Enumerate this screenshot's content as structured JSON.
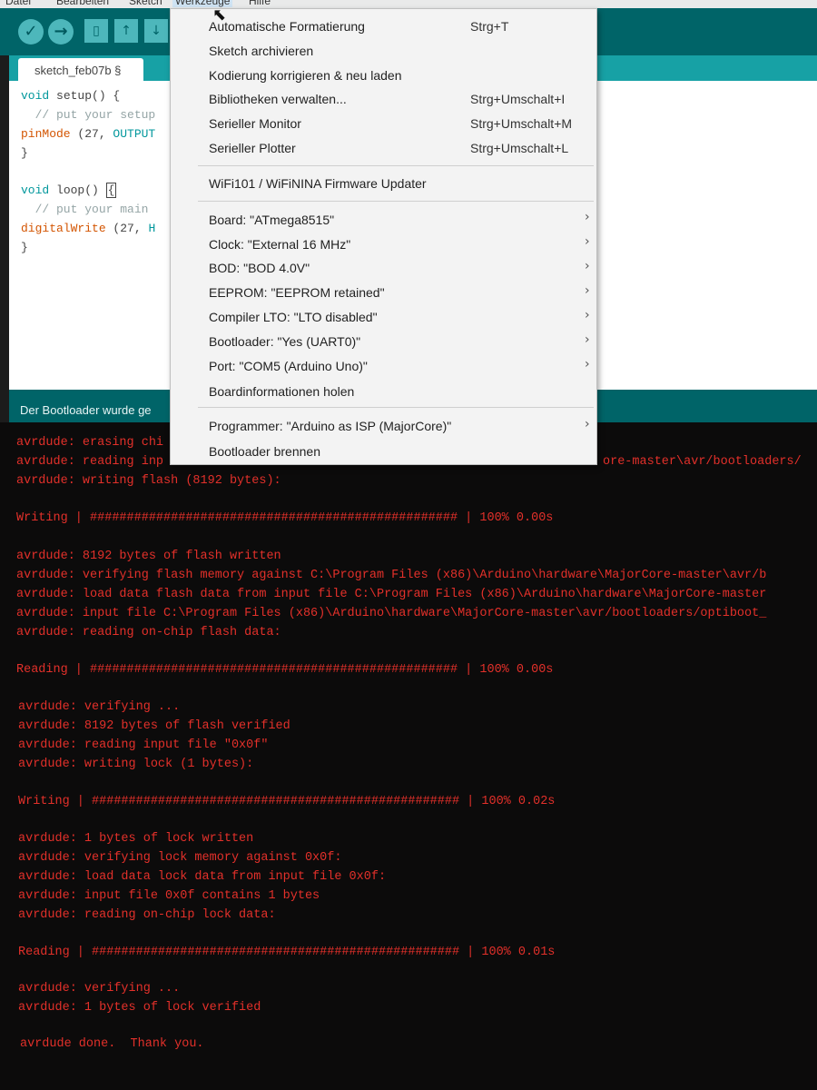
{
  "menubar": {
    "items": [
      "Datei",
      "Bearbeiten",
      "Sketch",
      "Werkzeuge",
      "Hilfe"
    ]
  },
  "toolbar": {
    "verify_icon": "check-icon",
    "upload_icon": "arrow-right-icon",
    "new_icon": "file-icon",
    "open_icon": "arrow-up-icon",
    "save_icon": "arrow-down-icon",
    "glyphs": {
      "verify": "✓",
      "upload": "→",
      "new": "▯",
      "open": "↑",
      "save": "↓"
    }
  },
  "tab": {
    "label": "sketch_feb07b §"
  },
  "editor": {
    "lines": [
      {
        "kw": "void",
        "rest": " setup() {"
      },
      {
        "comment": "  // put your setup"
      },
      {
        "fn": "pinMode",
        "rest": " (27, ",
        "const": "OUTPUT"
      },
      {
        "rest": "}"
      },
      {
        "rest": ""
      },
      {
        "kw": "void",
        "rest": " loop() ",
        "cursor": "{"
      },
      {
        "comment": "  // put your main"
      },
      {
        "fn": "digitalWrite",
        "rest": " (27, ",
        "const": "H"
      },
      {
        "rest": "}"
      }
    ]
  },
  "status": {
    "text": "Der Bootloader wurde ge"
  },
  "menu": {
    "items": [
      {
        "label": "Automatische Formatierung",
        "shortcut": "Strg+T"
      },
      {
        "label": "Sketch archivieren",
        "shortcut": ""
      },
      {
        "label": "Kodierung korrigieren & neu laden",
        "shortcut": ""
      },
      {
        "label": "Bibliotheken verwalten...",
        "shortcut": "Strg+Umschalt+I"
      },
      {
        "label": "Serieller Monitor",
        "shortcut": "Strg+Umschalt+M"
      },
      {
        "label": "Serieller Plotter",
        "shortcut": "Strg+Umschalt+L"
      },
      {
        "label": "WiFi101 / WiFiNINA Firmware Updater",
        "shortcut": ""
      },
      {
        "label": "Board: \"ATmega8515\"",
        "submenu": true
      },
      {
        "label": "Clock: \"External 16 MHz\"",
        "submenu": true
      },
      {
        "label": "BOD: \"BOD 4.0V\"",
        "submenu": true
      },
      {
        "label": "EEPROM: \"EEPROM retained\"",
        "submenu": true
      },
      {
        "label": "Compiler LTO: \"LTO disabled\"",
        "submenu": true
      },
      {
        "label": "Bootloader: \"Yes (UART0)\"",
        "submenu": true
      },
      {
        "label": "Port: \"COM5 (Arduino Uno)\"",
        "submenu": true
      },
      {
        "label": "Boardinformationen holen",
        "submenu": false
      },
      {
        "label": "Programmer: \"Arduino as ISP (MajorCore)\"",
        "submenu": true
      },
      {
        "label": "Bootloader brennen",
        "submenu": false
      }
    ],
    "chevron": "›"
  },
  "console": {
    "lines": [
      "avrdude: erasing chi",
      "avrdude: reading inp",
      "avrdude: writing flash (8192 bytes):",
      "",
      "Writing | ################################################## | 100% 0.00s",
      "",
      "avrdude: 8192 bytes of flash written",
      "avrdude: verifying flash memory against C:\\Program Files (x86)\\Arduino\\hardware\\MajorCore-master\\avr/b",
      "avrdude: load data flash data from input file C:\\Program Files (x86)\\Arduino\\hardware\\MajorCore-master",
      "avrdude: input file C:\\Program Files (x86)\\Arduino\\hardware\\MajorCore-master\\avr/bootloaders/optiboot_",
      "avrdude: reading on-chip flash data:",
      "",
      "Reading | ################################################## | 100% 0.00s",
      "",
      "avrdude: verifying ...",
      "avrdude: 8192 bytes of flash verified",
      "avrdude: reading input file \"0x0f\"",
      "avrdude: writing lock (1 bytes):",
      "",
      "Writing | ################################################## | 100% 0.02s",
      "",
      "avrdude: 1 bytes of lock written",
      "avrdude: verifying lock memory against 0x0f:",
      "avrdude: load data lock data from input file 0x0f:",
      "avrdude: input file 0x0f contains 1 bytes",
      "avrdude: reading on-chip lock data:",
      "",
      "Reading | ################################################## | 100% 0.01s",
      "",
      "avrdude: verifying ...",
      "avrdude: 1 bytes of lock verified",
      "",
      "avrdude done.  Thank you."
    ],
    "overflow_fragment": "ore-master\\avr/bootloaders/"
  },
  "colors": {
    "toolbar": "#006468",
    "tabstrip": "#17a1a5",
    "console_text": "#e3302a",
    "keyword": "#00979c",
    "function": "#d35400"
  }
}
